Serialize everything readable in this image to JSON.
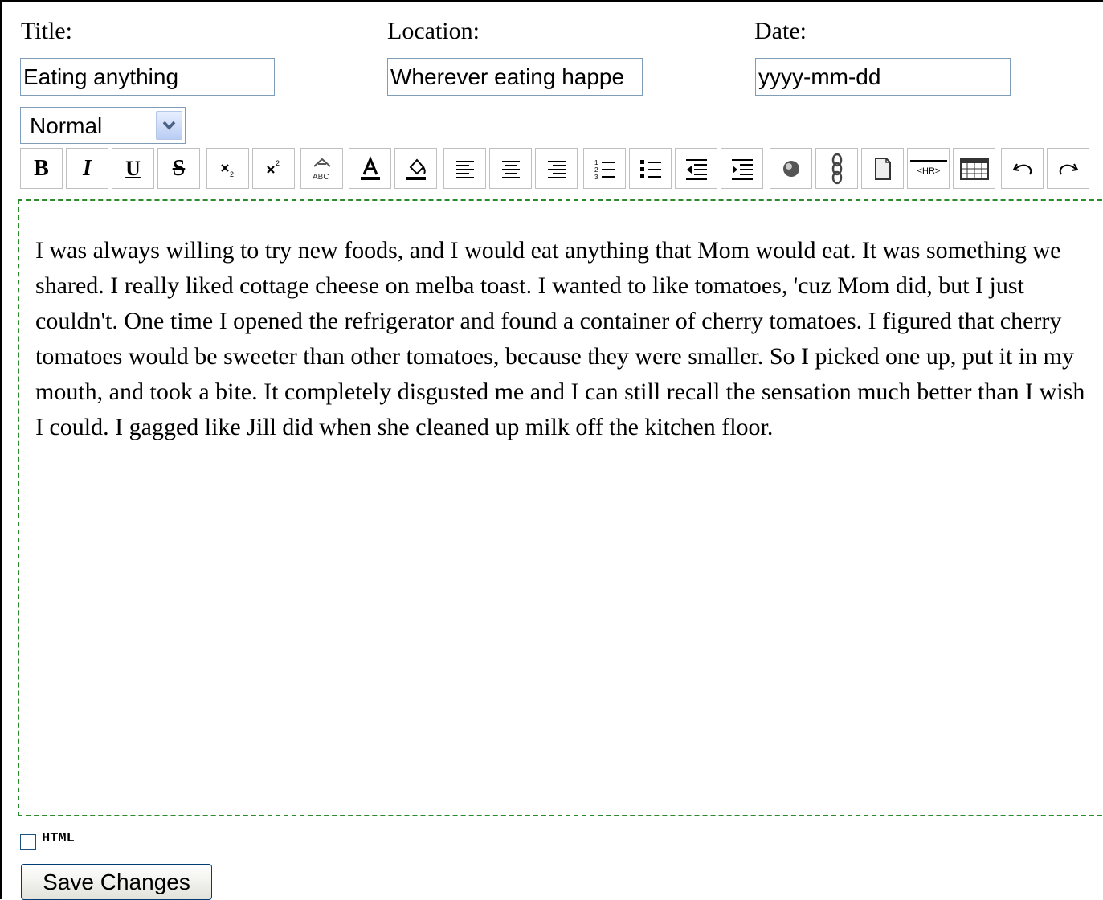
{
  "form": {
    "title_label": "Title:",
    "title_value": "Eating anything",
    "location_label": "Location:",
    "location_value": "Wherever eating happe",
    "date_label": "Date:",
    "date_value": "yyyy-mm-dd"
  },
  "toolbar": {
    "style_select_value": "Normal",
    "bold_glyph": "B",
    "italic_glyph": "I",
    "underline_glyph": "U",
    "strike_glyph": "S",
    "hr_label": "<HR>",
    "icons": [
      "bold-icon",
      "italic-icon",
      "underline-icon",
      "strikethrough-icon",
      "subscript-icon",
      "superscript-icon",
      "spellcheck-icon",
      "text-color-icon",
      "highlight-color-icon",
      "align-left-icon",
      "align-center-icon",
      "align-right-icon",
      "ordered-list-icon",
      "unordered-list-icon",
      "outdent-icon",
      "indent-icon",
      "insert-image-icon",
      "insert-link-icon",
      "insert-page-icon",
      "horizontal-rule-icon",
      "insert-table-icon",
      "undo-icon",
      "redo-icon"
    ]
  },
  "editor": {
    "content": "I was always willing to try new foods, and I would eat anything that Mom would eat. It was something we shared. I really liked cottage cheese on melba toast. I wanted to like tomatoes, 'cuz Mom did, but I just couldn't. One time I opened the refrigerator and found a container of cherry tomatoes. I figured that cherry tomatoes would be sweeter than other tomatoes, because they were smaller. So I picked one up, put it in my mouth, and took a bite. It completely disgusted me and I can still recall the sensation much better than I wish I could. I gagged like Jill did when she cleaned up milk off the kitchen floor."
  },
  "footer": {
    "html_checkbox_label": "HTML",
    "html_checkbox_checked": false,
    "save_label": "Save Changes"
  },
  "colors": {
    "editor_border": "#2b8a2b",
    "input_border": "#7f9db9",
    "button_border": "#c0c0c0"
  }
}
